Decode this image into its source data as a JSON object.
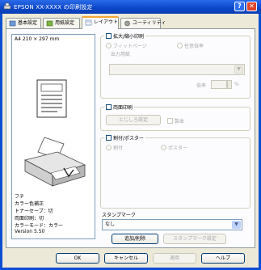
{
  "window": {
    "title": "EPSON XX-XXXX の印刷設定",
    "help_label": "?",
    "close_label": "✕"
  },
  "tabs": [
    {
      "label": "基本設定"
    },
    {
      "label": "用紙設定"
    },
    {
      "label": "レイアウト"
    },
    {
      "label": "ユーティリティ"
    }
  ],
  "preview": {
    "paper_size": "A4 210 × 297 mm",
    "info_lines": [
      "フチ",
      "カラー色補正",
      "トナーセーブ：切",
      "両面印刷：切",
      "カラーモード：カラー"
    ],
    "version": "Version 5.50"
  },
  "enlarge_group": {
    "title": "拡大/縮小印刷",
    "fit_page": "フィットページ",
    "custom": "任意倍率",
    "output_paper_label": "出力用紙",
    "output_paper_value": "",
    "ratio_label": "倍率",
    "ratio_value": "",
    "ratio_unit": "%"
  },
  "duplex_group": {
    "title": "両面印刷",
    "settings_button": "とじしろ設定",
    "booklet": "製本"
  },
  "multipage_group": {
    "title": "割付/ポスター",
    "n_up": "割付",
    "poster": "ポスター"
  },
  "stamp_group": {
    "title": "スタンプマーク",
    "value": "なし",
    "add_button": "追加/削除",
    "settings_button": "スタンプマーク設定"
  },
  "footer": {
    "ok": "OK",
    "cancel": "キャンセル",
    "apply": "適用",
    "help": "ヘルプ"
  },
  "colors": {
    "titlebar": "#0a46c8",
    "dialog_bg": "#ece9d8",
    "tab_highlight": "#f3a735"
  }
}
